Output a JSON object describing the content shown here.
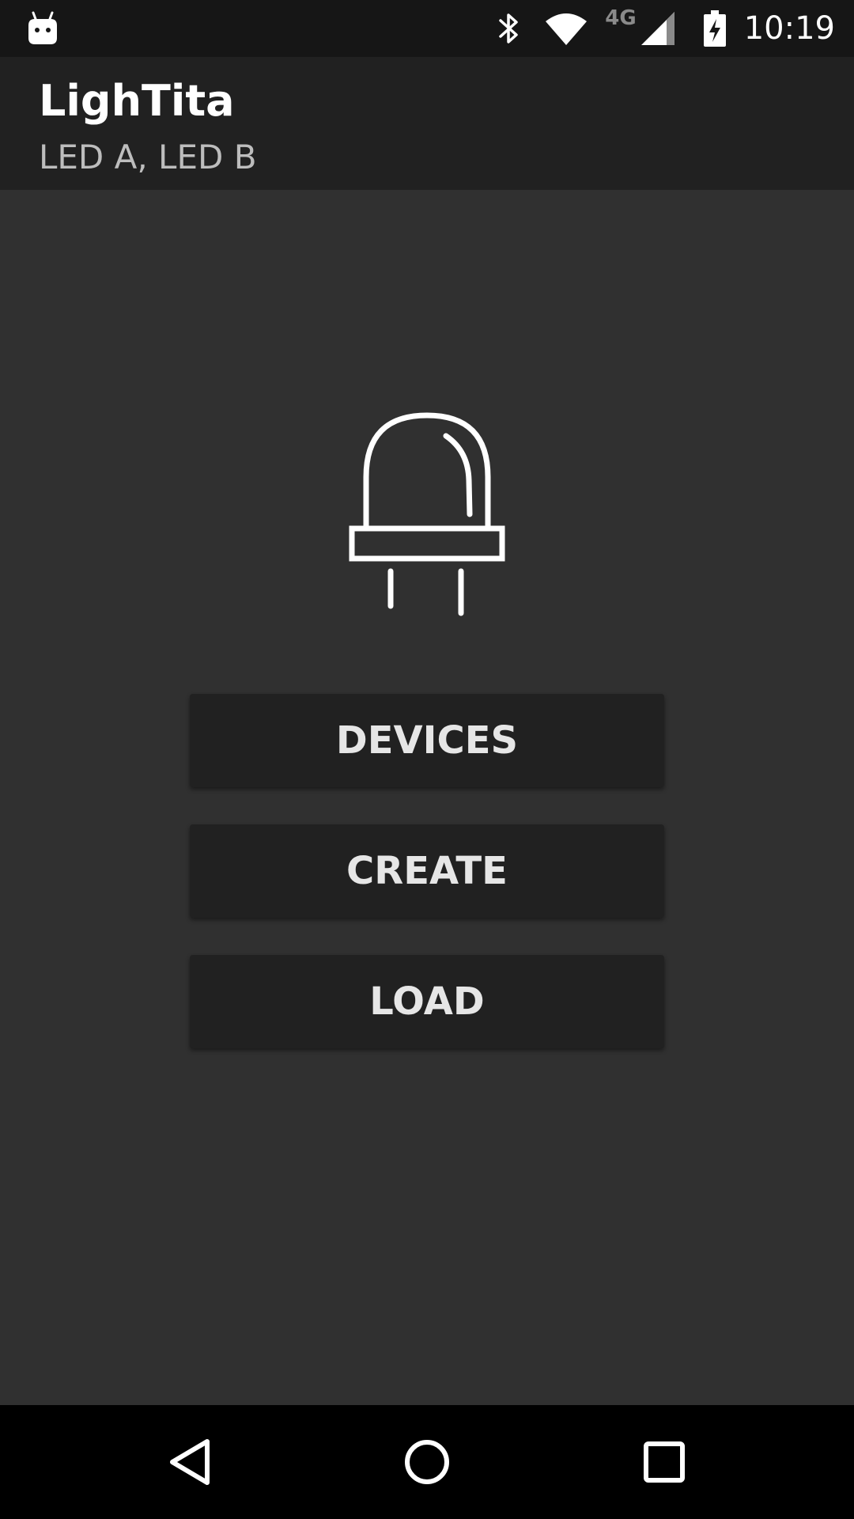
{
  "status_bar": {
    "time": "10:19",
    "network_type": "4G",
    "icons": [
      "android-notification-icon",
      "bluetooth-icon",
      "wifi-icon",
      "cell-signal-icon",
      "battery-charging-icon"
    ]
  },
  "app_bar": {
    "title": "LighTita",
    "subtitle": "LED A, LED B"
  },
  "main": {
    "illustration_icon": "led-icon",
    "buttons": [
      {
        "label": "DEVICES"
      },
      {
        "label": "CREATE"
      },
      {
        "label": "LOAD"
      }
    ]
  },
  "nav_bar": {
    "icons": [
      "back-icon",
      "home-icon",
      "recents-icon"
    ]
  },
  "colors": {
    "status_bar_bg": "#161616",
    "app_bar_bg": "#212121",
    "background": "#303030",
    "button_bg": "#212121",
    "button_text": "#e6e6e6",
    "nav_bar_bg": "#000000"
  }
}
